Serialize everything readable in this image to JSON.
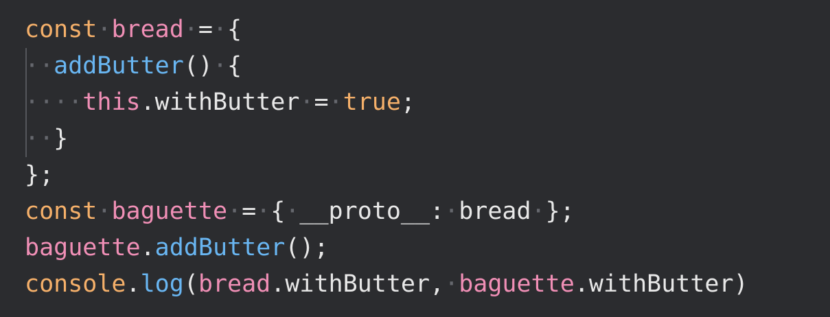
{
  "code": {
    "line1": {
      "keyword": "const",
      "name": "bread",
      "operator": "=",
      "brace": "{"
    },
    "line2": {
      "method": "addButter",
      "parens": "()",
      "brace": "{"
    },
    "line3": {
      "this_kw": "this",
      "dot": ".",
      "prop": "withButter",
      "operator": "=",
      "value": "true",
      "semi": ";"
    },
    "line4": {
      "brace": "}"
    },
    "line5": {
      "text": "};"
    },
    "line6": {
      "keyword": "const",
      "name": "baguette",
      "operator": "=",
      "brace_open": "{",
      "key": "__proto__",
      "colon": ":",
      "value": "bread",
      "brace_close": "};"
    },
    "line7": {
      "object": "baguette",
      "dot": ".",
      "method": "addButter",
      "call": "();"
    },
    "line8": {
      "object": "console",
      "dot": ".",
      "method": "log",
      "paren_open": "(",
      "arg1_obj": "bread",
      "arg1_dot": ".",
      "arg1_prop": "withButter",
      "comma": ",",
      "arg2_obj": "baguette",
      "arg2_dot": ".",
      "arg2_prop": "withButter",
      "paren_close": ")"
    }
  },
  "colors": {
    "background": "#2b2c2f",
    "keyword": "#f5b06a",
    "variable": "#f08fb6",
    "function": "#69b6f2",
    "text": "#e8e8e8",
    "whitespace_dot": "#66686e",
    "indent_guide": "#55575c"
  }
}
